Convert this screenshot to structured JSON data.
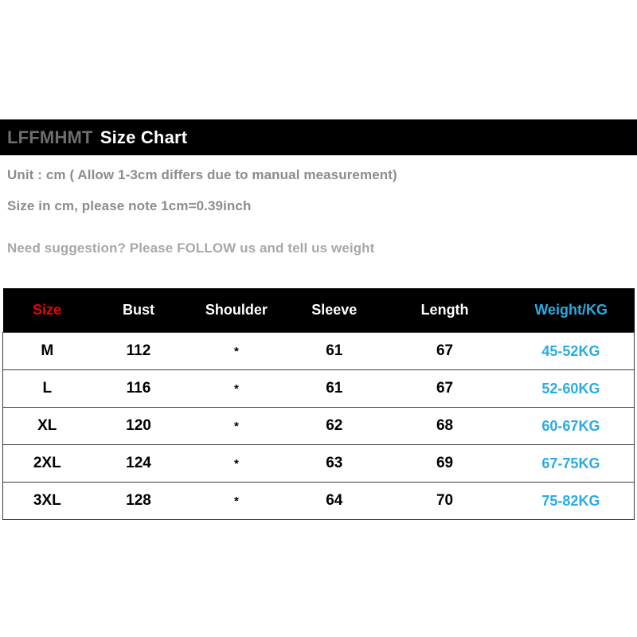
{
  "header": {
    "brand": "LFFMHMT",
    "title": "Size Chart"
  },
  "info": {
    "line1": "Unit : cm ( Allow 1-3cm differs due to manual measurement)",
    "line2": "Size in cm, please note 1cm=0.39inch",
    "line3": "Need suggestion? Please FOLLOW us and tell us weight"
  },
  "colors": {
    "banner_bg": "#000000",
    "size_header": "#ee0000",
    "weight_accent": "#29abe2",
    "brand_gray": "#6e6e6e",
    "info_gray": "#8c8c8c"
  },
  "chart_data": {
    "type": "table",
    "title": "Size Chart",
    "columns": [
      "Size",
      "Bust",
      "Shoulder",
      "Sleeve",
      "Length",
      "Weight/KG"
    ],
    "rows": [
      [
        "M",
        "112",
        "*",
        "61",
        "67",
        "45-52KG"
      ],
      [
        "L",
        "116",
        "*",
        "61",
        "67",
        "52-60KG"
      ],
      [
        "XL",
        "120",
        "*",
        "62",
        "68",
        "60-67KG"
      ],
      [
        "2XL",
        "124",
        "*",
        "63",
        "69",
        "67-75KG"
      ],
      [
        "3XL",
        "128",
        "*",
        "64",
        "70",
        "75-82KG"
      ]
    ]
  }
}
